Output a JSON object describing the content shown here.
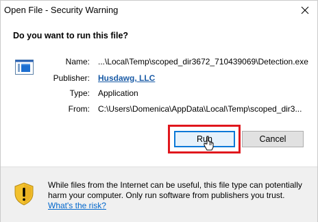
{
  "window": {
    "title": "Open File - Security Warning"
  },
  "prompt": {
    "question": "Do you want to run this file?"
  },
  "details": {
    "name_label": "Name:",
    "name_value": "...\\Local\\Temp\\scoped_dir3672_710439069\\Detection.exe",
    "publisher_label": "Publisher:",
    "publisher_value": "Husdawg, LLC",
    "type_label": "Type:",
    "type_value": "Application",
    "from_label": "From:",
    "from_value": "C:\\Users\\Domenica\\AppData\\Local\\Temp\\scoped_dir3..."
  },
  "buttons": {
    "run_label": "Run",
    "cancel_label": "Cancel"
  },
  "footer": {
    "warning_text": "While files from the Internet can be useful, this file type can potentially harm your computer. Only run software from publishers you trust.",
    "risk_link": "What's the risk?"
  },
  "colors": {
    "highlight": "#e0161c",
    "link": "#1a5ba6",
    "focus_border": "#0b78d7",
    "shield": "#f2c12e"
  },
  "icons": {
    "close": "close-icon",
    "file": "application-file-icon",
    "shield": "warning-shield-icon",
    "cursor": "mouse-cursor-icon"
  }
}
